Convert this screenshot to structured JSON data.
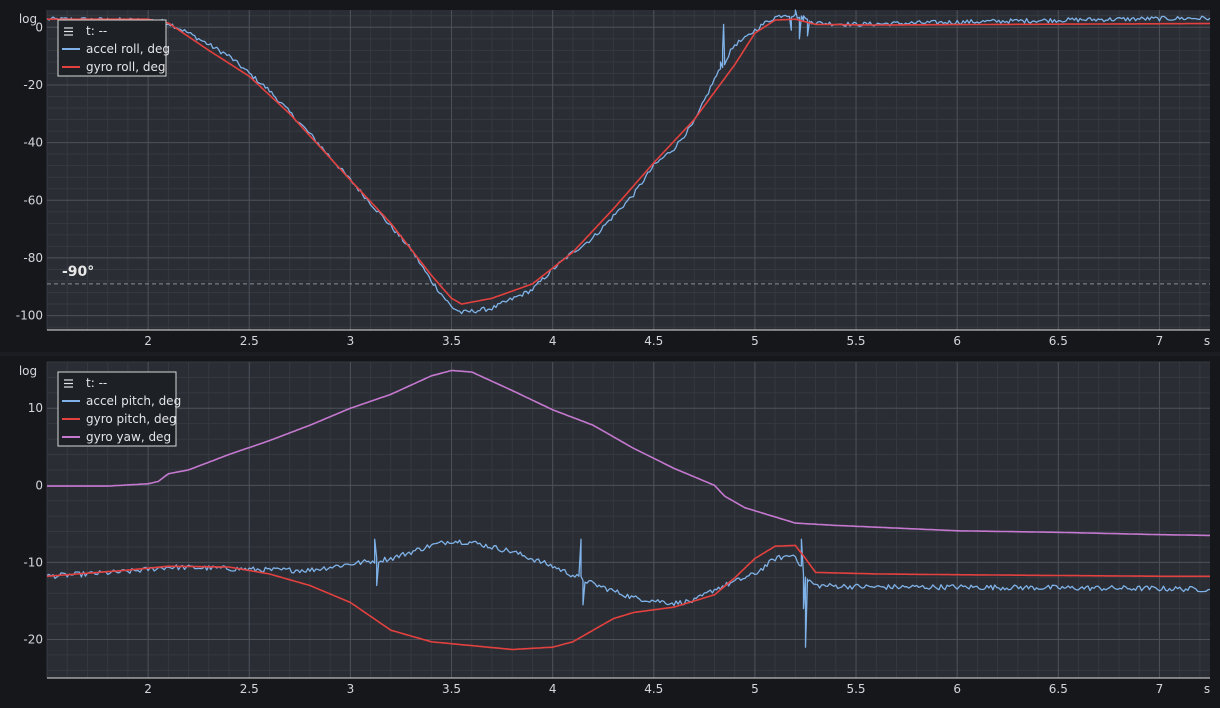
{
  "chart_data": [
    {
      "type": "line",
      "y_scale_label": "log",
      "x_unit_label": "s",
      "xlim": [
        1.5,
        7.25
      ],
      "ylim": [
        -105,
        6
      ],
      "x_ticks": [
        2,
        2.5,
        3,
        3.5,
        4,
        4.5,
        5,
        5.5,
        6,
        6.5,
        7
      ],
      "y_ticks": [
        0,
        -20,
        -40,
        -60,
        -80,
        -100
      ],
      "legend": {
        "cursor_label": "t: --",
        "placement": "top-left"
      },
      "annotation": {
        "label": "-90°",
        "y": -89,
        "style": "dashed"
      },
      "series": [
        {
          "name": "accel roll, deg",
          "color": "#7fb2e8",
          "noise": 0.8,
          "points": [
            [
              1.5,
              2.8
            ],
            [
              1.7,
              2.7
            ],
            [
              1.9,
              2.5
            ],
            [
              2.05,
              2.3
            ],
            [
              2.1,
              1.5
            ],
            [
              2.2,
              -2
            ],
            [
              2.4,
              -10
            ],
            [
              2.5,
              -16
            ],
            [
              2.6,
              -22
            ],
            [
              2.8,
              -37
            ],
            [
              3.0,
              -53
            ],
            [
              3.2,
              -69
            ],
            [
              3.3,
              -77
            ],
            [
              3.4,
              -88
            ],
            [
              3.5,
              -97
            ],
            [
              3.55,
              -99
            ],
            [
              3.7,
              -97.5
            ],
            [
              3.9,
              -91
            ],
            [
              4.0,
              -84
            ],
            [
              4.1,
              -78
            ],
            [
              4.2,
              -73
            ],
            [
              4.4,
              -58
            ],
            [
              4.5,
              -48
            ],
            [
              4.6,
              -42
            ],
            [
              4.7,
              -33
            ],
            [
              4.8,
              -18
            ],
            [
              4.85,
              -12
            ],
            [
              4.9,
              -6
            ],
            [
              4.95,
              -4
            ],
            [
              5.0,
              -1
            ],
            [
              5.05,
              1.5
            ],
            [
              5.1,
              3.5
            ],
            [
              5.15,
              4.5
            ],
            [
              5.2,
              4
            ],
            [
              5.3,
              1.5
            ],
            [
              5.5,
              1
            ],
            [
              6.0,
              1.8
            ],
            [
              6.5,
              2.5
            ],
            [
              7.0,
              3.0
            ],
            [
              7.25,
              3.2
            ]
          ],
          "spikes": [
            [
              4.83,
              -12
            ],
            [
              4.84,
              -8
            ],
            [
              4.845,
              1
            ],
            [
              4.85,
              -13
            ],
            [
              5.18,
              -1
            ],
            [
              5.2,
              6
            ],
            [
              5.22,
              -4
            ],
            [
              5.24,
              4
            ],
            [
              5.26,
              -3
            ],
            [
              5.28,
              2
            ]
          ]
        },
        {
          "name": "gyro roll, deg",
          "color": "#e2413f",
          "noise": 0,
          "points": [
            [
              1.5,
              2.8
            ],
            [
              2.0,
              2.8
            ],
            [
              2.1,
              1.5
            ],
            [
              2.3,
              -8
            ],
            [
              2.5,
              -17
            ],
            [
              2.7,
              -30
            ],
            [
              3.0,
              -53
            ],
            [
              3.2,
              -68
            ],
            [
              3.4,
              -86
            ],
            [
              3.5,
              -94
            ],
            [
              3.55,
              -96
            ],
            [
              3.7,
              -94
            ],
            [
              3.9,
              -89
            ],
            [
              4.1,
              -78
            ],
            [
              4.3,
              -63
            ],
            [
              4.5,
              -47
            ],
            [
              4.7,
              -32
            ],
            [
              4.9,
              -13
            ],
            [
              5.0,
              -2
            ],
            [
              5.1,
              2.5
            ],
            [
              5.2,
              2.8
            ],
            [
              5.3,
              1
            ],
            [
              5.6,
              0.8
            ],
            [
              6.2,
              1.0
            ],
            [
              7.25,
              1.3
            ]
          ],
          "spikes": []
        }
      ]
    },
    {
      "type": "line",
      "y_scale_label": "log",
      "x_unit_label": "s",
      "xlim": [
        1.5,
        7.25
      ],
      "ylim": [
        -25,
        16
      ],
      "x_ticks": [
        2,
        2.5,
        3,
        3.5,
        4,
        4.5,
        5,
        5.5,
        6,
        6.5,
        7
      ],
      "y_ticks": [
        10,
        0,
        -10,
        -20
      ],
      "legend": {
        "cursor_label": "t: --",
        "placement": "top-left"
      },
      "series": [
        {
          "name": "accel pitch, deg",
          "color": "#7fb2e8",
          "noise": 0.35,
          "points": [
            [
              1.5,
              -11.8
            ],
            [
              1.9,
              -11.2
            ],
            [
              2.1,
              -10.6
            ],
            [
              2.4,
              -10.8
            ],
            [
              2.6,
              -11.0
            ],
            [
              2.8,
              -11.0
            ],
            [
              3.0,
              -10.2
            ],
            [
              3.2,
              -9.5
            ],
            [
              3.4,
              -7.8
            ],
            [
              3.5,
              -7.2
            ],
            [
              3.6,
              -7.4
            ],
            [
              3.8,
              -8.6
            ],
            [
              4.0,
              -10.5
            ],
            [
              4.2,
              -12.8
            ],
            [
              4.4,
              -14.6
            ],
            [
              4.6,
              -15.3
            ],
            [
              4.7,
              -15.0
            ],
            [
              4.8,
              -13.5
            ],
            [
              4.9,
              -12.5
            ],
            [
              5.0,
              -11.5
            ],
            [
              5.1,
              -9.5
            ],
            [
              5.2,
              -9.0
            ],
            [
              5.25,
              -12.0
            ],
            [
              5.3,
              -13.0
            ],
            [
              5.6,
              -13.2
            ],
            [
              6.0,
              -13.2
            ],
            [
              6.5,
              -13.3
            ],
            [
              7.0,
              -13.4
            ],
            [
              7.25,
              -13.5
            ]
          ],
          "spikes": [
            [
              3.12,
              -7.0
            ],
            [
              3.13,
              -13.0
            ],
            [
              4.14,
              -7.0
            ],
            [
              4.15,
              -15.5
            ],
            [
              5.23,
              -7.0
            ],
            [
              5.24,
              -16.0
            ],
            [
              5.25,
              -21.0
            ],
            [
              5.26,
              -12.5
            ]
          ]
        },
        {
          "name": "gyro pitch, deg",
          "color": "#e2413f",
          "noise": 0,
          "points": [
            [
              1.5,
              -11.8
            ],
            [
              1.9,
              -11.0
            ],
            [
              2.1,
              -10.5
            ],
            [
              2.4,
              -10.6
            ],
            [
              2.6,
              -11.5
            ],
            [
              2.8,
              -13.0
            ],
            [
              3.0,
              -15.2
            ],
            [
              3.1,
              -17.0
            ],
            [
              3.2,
              -18.8
            ],
            [
              3.4,
              -20.3
            ],
            [
              3.6,
              -20.8
            ],
            [
              3.8,
              -21.3
            ],
            [
              4.0,
              -21.0
            ],
            [
              4.1,
              -20.3
            ],
            [
              4.2,
              -18.8
            ],
            [
              4.3,
              -17.3
            ],
            [
              4.4,
              -16.5
            ],
            [
              4.6,
              -15.8
            ],
            [
              4.8,
              -14.2
            ],
            [
              4.9,
              -12.0
            ],
            [
              5.0,
              -9.5
            ],
            [
              5.1,
              -7.9
            ],
            [
              5.2,
              -7.8
            ],
            [
              5.25,
              -9.5
            ],
            [
              5.3,
              -11.3
            ],
            [
              5.6,
              -11.5
            ],
            [
              6.0,
              -11.6
            ],
            [
              6.5,
              -11.7
            ],
            [
              7.0,
              -11.8
            ],
            [
              7.25,
              -11.8
            ]
          ],
          "spikes": []
        },
        {
          "name": "gyro yaw, deg",
          "color": "#c478cf",
          "noise": 0,
          "points": [
            [
              1.5,
              -0.1
            ],
            [
              1.8,
              -0.1
            ],
            [
              2.0,
              0.2
            ],
            [
              2.05,
              0.5
            ],
            [
              2.1,
              1.5
            ],
            [
              2.2,
              2.0
            ],
            [
              2.4,
              4.0
            ],
            [
              2.6,
              5.8
            ],
            [
              2.8,
              7.8
            ],
            [
              3.0,
              10.0
            ],
            [
              3.2,
              11.8
            ],
            [
              3.4,
              14.2
            ],
            [
              3.5,
              14.9
            ],
            [
              3.6,
              14.7
            ],
            [
              3.8,
              12.3
            ],
            [
              4.0,
              9.8
            ],
            [
              4.2,
              7.8
            ],
            [
              4.4,
              4.8
            ],
            [
              4.6,
              2.2
            ],
            [
              4.8,
              0.0
            ],
            [
              4.85,
              -1.4
            ],
            [
              4.95,
              -2.9
            ],
            [
              5.0,
              -3.3
            ],
            [
              5.2,
              -4.9
            ],
            [
              5.4,
              -5.2
            ],
            [
              6.0,
              -5.9
            ],
            [
              6.5,
              -6.1
            ],
            [
              7.0,
              -6.4
            ],
            [
              7.25,
              -6.5
            ]
          ],
          "spikes": []
        }
      ]
    }
  ]
}
